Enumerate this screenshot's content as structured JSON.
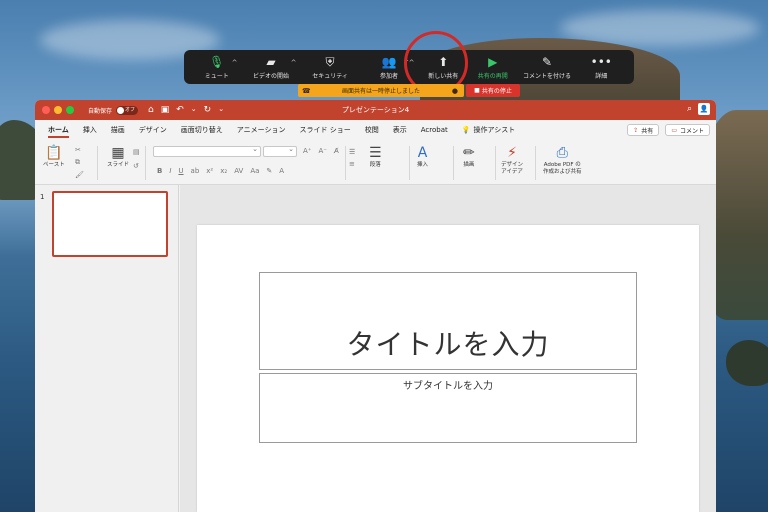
{
  "zoom_toolbar": {
    "items": [
      {
        "label": "ミュート",
        "icon": "microphone-icon"
      },
      {
        "label": "ビデオの開始",
        "icon": "video-off-icon"
      },
      {
        "label": "セキュリティ",
        "icon": "shield-icon"
      },
      {
        "label": "参加者",
        "icon": "participants-icon",
        "count": "1"
      },
      {
        "label": "新しい共有",
        "icon": "new-share-icon"
      },
      {
        "label": "共有の再開",
        "icon": "play-icon"
      },
      {
        "label": "コメントを付ける",
        "icon": "pencil-icon"
      },
      {
        "label": "詳細",
        "icon": "more-icon"
      }
    ],
    "banner_text": "画面共有は一時停止しました",
    "stop_share_label": "共有の停止",
    "resume_color": "#37c66a",
    "stop_color": "#d9342b",
    "banner_color": "#f4a51b"
  },
  "powerpoint": {
    "window_title": "プレゼンテーション4",
    "autosave_label": "自動保存",
    "autosave_state": "オフ",
    "accent_color": "#c1432e",
    "tabs": [
      "ホーム",
      "挿入",
      "描画",
      "デザイン",
      "画面切り替え",
      "アニメーション",
      "スライド ショー",
      "校閲",
      "表示",
      "Acrobat"
    ],
    "assist_label": "操作アシスト",
    "share_label": "共有",
    "comment_label": "コメント",
    "ribbon": {
      "paste": "ペースト",
      "slide": "スライド",
      "paragraph": "段落",
      "insert": "挿入",
      "draw": "描画",
      "design_ideas": "デザイン\nアイデア",
      "adobe_pdf": "Adobe PDF の\n作成および共有"
    },
    "slide_number": "1",
    "slide": {
      "title_placeholder": "タイトルを入力",
      "subtitle_placeholder": "サブタイトルを入力"
    }
  }
}
